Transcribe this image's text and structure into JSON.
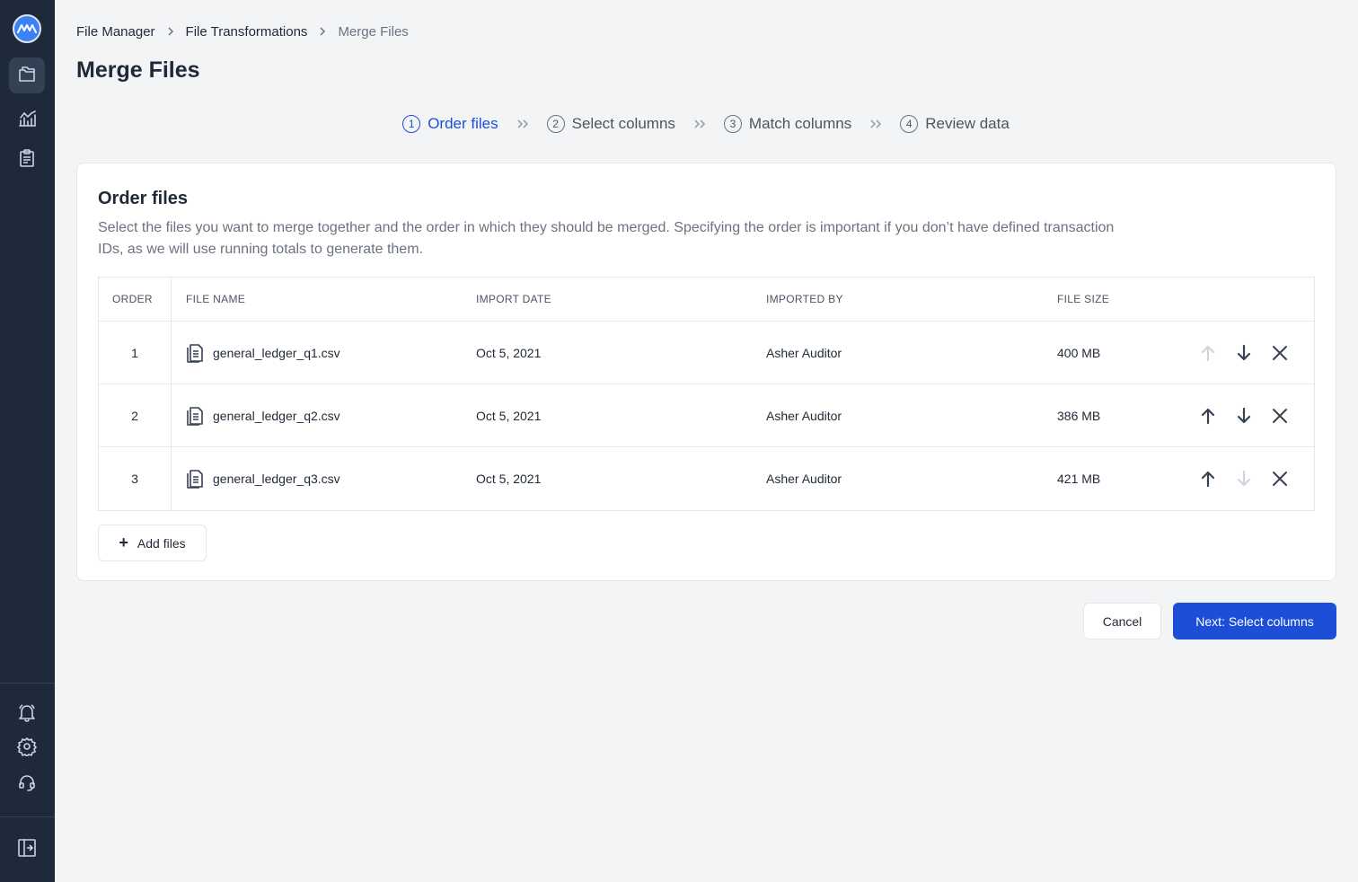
{
  "sidebar": {
    "logo": "logo-icon",
    "nav": [
      {
        "icon": "folders-icon",
        "active": true
      },
      {
        "icon": "analytics-chart-icon",
        "active": false
      },
      {
        "icon": "clipboard-icon",
        "active": false
      }
    ],
    "bottom": [
      {
        "icon": "bell-icon"
      },
      {
        "icon": "gear-icon"
      },
      {
        "icon": "headset-icon"
      }
    ],
    "collapse": {
      "icon": "sidebar-collapse-icon"
    }
  },
  "breadcrumb": [
    "File Manager",
    "File Transformations",
    "Merge Files"
  ],
  "page_title": "Merge Files",
  "steps": [
    {
      "num": "1",
      "label": "Order files",
      "active": true
    },
    {
      "num": "2",
      "label": "Select columns",
      "active": false
    },
    {
      "num": "3",
      "label": "Match columns",
      "active": false
    },
    {
      "num": "4",
      "label": "Review data",
      "active": false
    }
  ],
  "card": {
    "title": "Order files",
    "description": "Select the files you want to merge together and the order in which they should be merged. Specifying the order is important if you don’t have defined transaction IDs, as we will use running totals to generate them."
  },
  "table": {
    "headers": [
      "ORDER",
      "FILE NAME",
      "IMPORT DATE",
      "IMPORTED BY",
      "FILE SIZE"
    ],
    "rows": [
      {
        "order": "1",
        "name": "general_ledger_q1.csv",
        "date": "Oct 5, 2021",
        "by": "Asher Auditor",
        "size": "400 MB",
        "up_enabled": false,
        "down_enabled": true
      },
      {
        "order": "2",
        "name": "general_ledger_q2.csv",
        "date": "Oct 5, 2021",
        "by": "Asher Auditor",
        "size": "386 MB",
        "up_enabled": true,
        "down_enabled": true
      },
      {
        "order": "3",
        "name": "general_ledger_q3.csv",
        "date": "Oct 5, 2021",
        "by": "Asher Auditor",
        "size": "421 MB",
        "up_enabled": true,
        "down_enabled": false
      }
    ]
  },
  "add_files_label": "Add files",
  "cancel_label": "Cancel",
  "next_label": "Next: Select columns",
  "colors": {
    "sidebar": "#1e293b",
    "primary": "#1d4ed8",
    "background": "#f2f4f6"
  }
}
